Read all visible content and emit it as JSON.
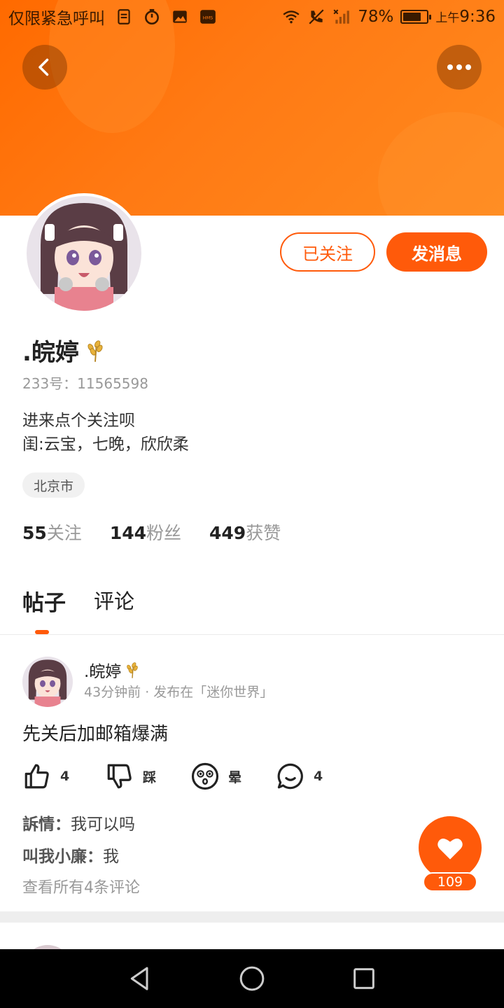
{
  "status_bar": {
    "carrier": "仅限紧急呼叫",
    "battery": "78%",
    "battery_level": 0.78,
    "time_prefix": "上午",
    "time": "9:36"
  },
  "header": {
    "back_icon": "chevron-left-icon",
    "more_icon": "more-dots-icon",
    "banner_color": "#ff7a14"
  },
  "profile": {
    "followed_label": "已关注",
    "message_label": "发消息",
    "username": ".皖婷",
    "uid": "233号：11565598",
    "bio_line1": "进来点个关注呗",
    "bio_line2": "闺:云宝，七晚，欣欣柔",
    "location": "北京市",
    "stats": [
      {
        "num": "55",
        "label": "关注"
      },
      {
        "num": "144",
        "label": "粉丝"
      },
      {
        "num": "449",
        "label": "获赞"
      }
    ]
  },
  "tabs": [
    {
      "label": "帖子",
      "active": true
    },
    {
      "label": "评论",
      "active": false
    }
  ],
  "post": {
    "author": ".皖婷",
    "meta": "43分钟前 · 发布在「迷你世界」",
    "text": "先关后加邮箱爆满",
    "actions": [
      {
        "icon": "thumbs-up-icon",
        "label": "4"
      },
      {
        "icon": "thumbs-down-icon",
        "label": "踩"
      },
      {
        "icon": "dizzy-face-icon",
        "label": "晕"
      },
      {
        "icon": "comment-bubble-icon",
        "label": "4"
      }
    ],
    "comments": [
      {
        "name": "訴情：",
        "text": "我可以吗"
      },
      {
        "name": "叫我小廉：",
        "text": "我"
      }
    ],
    "view_all": "查看所有4条评论",
    "like_count": "109"
  },
  "colors": {
    "accent": "#ff5a0a"
  }
}
